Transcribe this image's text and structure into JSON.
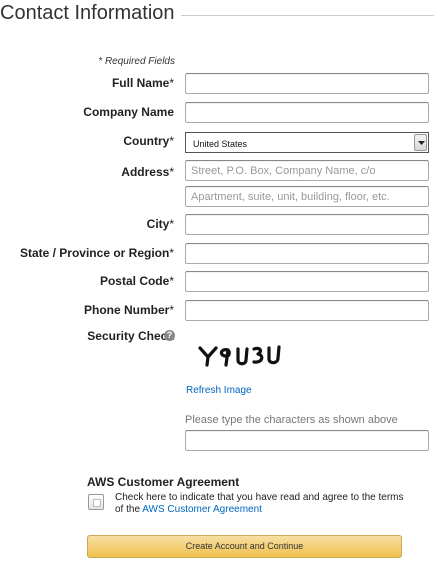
{
  "section": {
    "title": "Contact Information"
  },
  "form": {
    "required_note": "* Required Fields",
    "full_name": {
      "label": "Full Name",
      "required_mark": "*",
      "value": ""
    },
    "company_name": {
      "label": "Company Name",
      "value": ""
    },
    "country": {
      "label": "Country",
      "required_mark": "*",
      "selected": "United States"
    },
    "address": {
      "label": "Address",
      "required_mark": "*",
      "line1_placeholder": "Street, P.O. Box, Company Name, c/o",
      "line2_placeholder": "Apartment, suite, unit, building, floor, etc."
    },
    "city": {
      "label": "City",
      "required_mark": "*",
      "value": ""
    },
    "state": {
      "label": "State / Province or Region",
      "required_mark": "*",
      "value": ""
    },
    "postal_code": {
      "label": "Postal Code",
      "required_mark": "*",
      "value": ""
    },
    "phone": {
      "label": "Phone Number",
      "required_mark": "*",
      "value": ""
    },
    "security": {
      "label": "Security Check",
      "help_icon": "question-circle-icon",
      "captcha_text": "Y9U3U",
      "refresh_label": "Refresh Image",
      "hint": "Please type the characters as shown above",
      "value": ""
    }
  },
  "agreement": {
    "title": "AWS Customer Agreement",
    "text_prefix": "Check here to indicate that you have read and agree to the terms of the ",
    "link_text": "AWS Customer Agreement",
    "checked": false
  },
  "submit": {
    "label": "Create Account and Continue"
  },
  "colors": {
    "link": "#0066c0",
    "button_top": "#f7dfa5",
    "button_bottom": "#f0c14b"
  }
}
